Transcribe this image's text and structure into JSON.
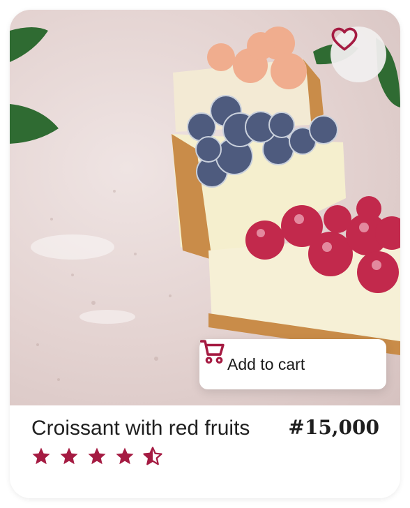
{
  "product": {
    "name": "Croissant with red fruits",
    "price": "#15,000",
    "rating": 4.5,
    "rating_max": 5
  },
  "actions": {
    "add_to_cart_label": "Add to cart"
  },
  "icons": {
    "favorite": "heart-outline-icon",
    "cart": "cart-icon",
    "star": "star-icon"
  },
  "colors": {
    "accent": "#a51b42",
    "text": "#1f1f1f",
    "card_bg": "#ffffff"
  }
}
